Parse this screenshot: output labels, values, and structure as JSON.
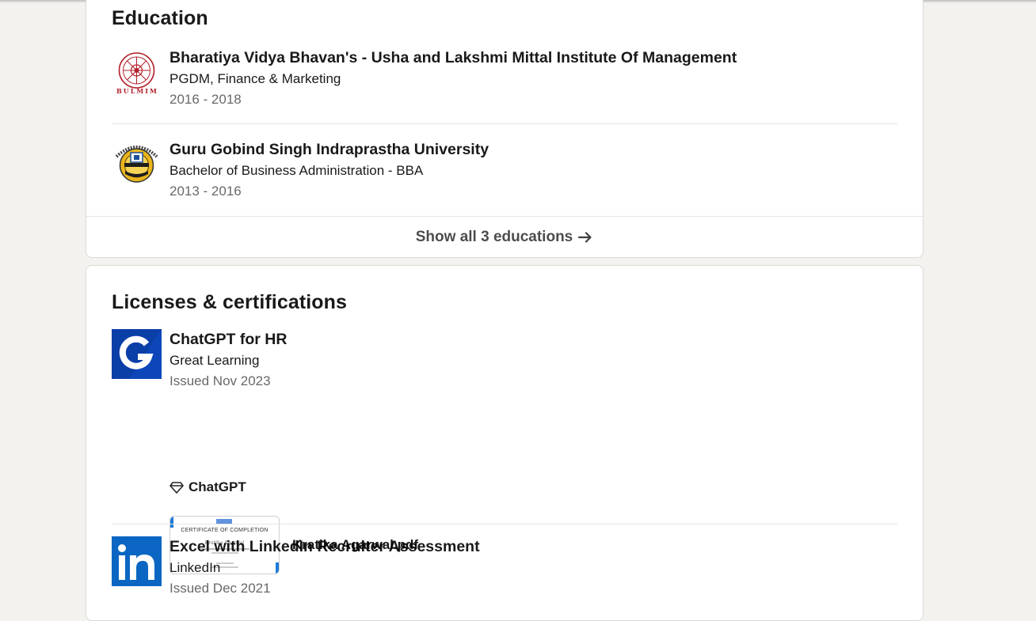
{
  "education": {
    "title": "Education",
    "items": [
      {
        "school": "Bharatiya Vidya Bhavan's - Usha and Lakshmi Mittal Institute Of Management",
        "degree": "PGDM, Finance & Marketing",
        "dates": "2016 - 2018",
        "logo_icon": "bulmim-seal-icon",
        "logo_text": "BULMIM"
      },
      {
        "school": "Guru Gobind Singh Indraprastha University",
        "degree": "Bachelor of Business Administration - BBA",
        "dates": "2013 - 2016",
        "logo_icon": "ggsipu-emblem-icon"
      }
    ],
    "show_all_label": "Show all 3 educations"
  },
  "licenses": {
    "title": "Licenses & certifications",
    "items": [
      {
        "name": "ChatGPT for HR",
        "issuer": "Great Learning",
        "issued": "Issued Nov 2023",
        "logo_icon": "great-learning-logo-icon",
        "skill": "ChatGPT",
        "skill_icon": "diamond-icon",
        "media": {
          "file_name": "Kratika Agarwal.pdf",
          "thumb_heading": "CERTIFICATE OF COMPLETION",
          "thumb_name": "Kratika Agarwal"
        }
      },
      {
        "name": "Excel with LinkedIn Recruiter Assessment",
        "issuer": "LinkedIn",
        "issued": "Issued Dec 2021",
        "logo_icon": "linkedin-logo-icon"
      }
    ]
  },
  "colors": {
    "page_bg": "#f4f2ee",
    "card_bg": "#ffffff",
    "great_learning_blue": "#0b3fa8",
    "linkedin_blue": "#0a66c2"
  }
}
